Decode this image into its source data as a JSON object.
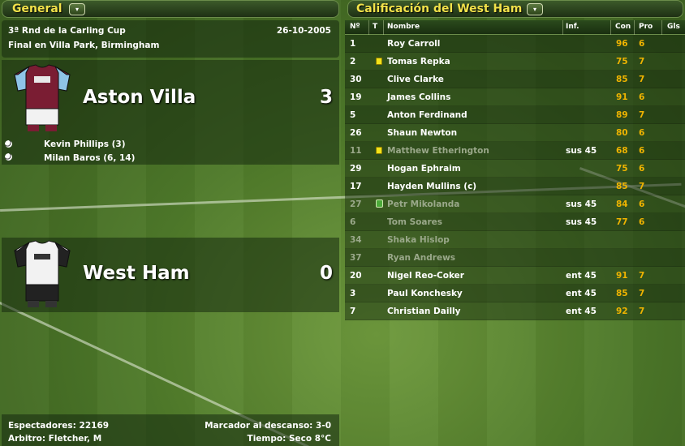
{
  "general_panel": {
    "header": "General",
    "dropdown_glyph": "▾",
    "competition": "3ª Rnd de la Carling Cup",
    "date": "26-10-2005",
    "venue": "Final en Villa Park, Birmingham"
  },
  "home_team": {
    "name": "Aston Villa",
    "score": "3",
    "kit_colors": {
      "body": "#7a1d33",
      "sleeves": "#8fc4e8"
    },
    "scorers": [
      "Kevin Phillips (3)",
      "Milan Baros (6, 14)"
    ]
  },
  "away_team": {
    "name": "West Ham",
    "score": "0",
    "kit_colors": {
      "body": "#f2f2f2",
      "sleeves": "#222222"
    }
  },
  "match_footer": {
    "spectators": "Espectadores: 22169",
    "referee": "Arbitro: Fletcher, M",
    "halftime": "Marcador al descanso: 3-0",
    "weather": "Tiempo: Seco 8°C"
  },
  "ratings_panel": {
    "header": "Calificación del West Ham",
    "dropdown_glyph": "▾",
    "columns": [
      "Nº",
      "T",
      "Nombre",
      "Inf.",
      "Con",
      "Pro",
      "Gls"
    ],
    "rows": [
      {
        "num": "1",
        "name": "Roy Carroll",
        "inf": "",
        "con": "96",
        "pro": "6",
        "card": "",
        "dim": false
      },
      {
        "num": "2",
        "name": "Tomas Repka",
        "inf": "",
        "con": "75",
        "pro": "7",
        "card": "yellow",
        "dim": false
      },
      {
        "num": "30",
        "name": "Clive Clarke",
        "inf": "",
        "con": "85",
        "pro": "7",
        "card": "",
        "dim": false
      },
      {
        "num": "19",
        "name": "James Collins",
        "inf": "",
        "con": "91",
        "pro": "6",
        "card": "",
        "dim": false
      },
      {
        "num": "5",
        "name": "Anton Ferdinand",
        "inf": "",
        "con": "89",
        "pro": "7",
        "card": "",
        "dim": false
      },
      {
        "num": "26",
        "name": "Shaun Newton",
        "inf": "",
        "con": "80",
        "pro": "6",
        "card": "",
        "dim": false
      },
      {
        "num": "11",
        "name": "Matthew Etherington",
        "inf": "sus 45",
        "con": "68",
        "pro": "6",
        "card": "yellow",
        "dim": true
      },
      {
        "num": "29",
        "name": "Hogan Ephraim",
        "inf": "",
        "con": "75",
        "pro": "6",
        "card": "",
        "dim": false
      },
      {
        "num": "17",
        "name": "Hayden Mullins (c)",
        "inf": "",
        "con": "85",
        "pro": "7",
        "card": "",
        "dim": false
      },
      {
        "num": "27",
        "name": "Petr Mikolanda",
        "inf": "sus 45",
        "con": "84",
        "pro": "6",
        "card": "sub",
        "dim": true
      },
      {
        "num": "6",
        "name": "Tom Soares",
        "inf": "sus 45",
        "con": "77",
        "pro": "6",
        "card": "",
        "dim": true
      },
      {
        "num": "34",
        "name": "Shaka Hislop",
        "inf": "",
        "con": "",
        "pro": "",
        "card": "",
        "dim": true
      },
      {
        "num": "37",
        "name": "Ryan Andrews",
        "inf": "",
        "con": "",
        "pro": "",
        "card": "",
        "dim": true
      },
      {
        "num": "20",
        "name": "Nigel Reo-Coker",
        "inf": "ent 45",
        "con": "91",
        "pro": "7",
        "card": "",
        "dim": false
      },
      {
        "num": "3",
        "name": "Paul Konchesky",
        "inf": "ent 45",
        "con": "85",
        "pro": "7",
        "card": "",
        "dim": false
      },
      {
        "num": "7",
        "name": "Christian Dailly",
        "inf": "ent 45",
        "con": "92",
        "pro": "7",
        "card": "",
        "dim": false
      }
    ]
  }
}
